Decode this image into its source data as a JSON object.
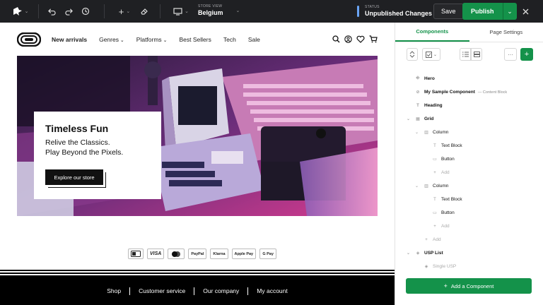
{
  "toolbar": {
    "store_view_caption": "STORE VIEW",
    "store_view_value": "Belgium",
    "status_caption": "STATUS",
    "status_value": "Unpublished Changes",
    "save_label": "Save",
    "publish_label": "Publish",
    "status_color": "#6aa5f5",
    "publish_color": "#14924a"
  },
  "store": {
    "nav": [
      {
        "label": "New arrivals",
        "active": true
      },
      {
        "label": "Genres",
        "dropdown": true
      },
      {
        "label": "Platforms",
        "dropdown": true
      },
      {
        "label": "Best Sellers"
      },
      {
        "label": "Tech"
      },
      {
        "label": "Sale",
        "color": "#e0262b"
      }
    ],
    "hero": {
      "title": "Timeless Fun",
      "subtitle_line1": "Relive the Classics.",
      "subtitle_line2": "Play Beyond the Pixels.",
      "button_label": "Explore our store"
    },
    "payments": [
      "VISA",
      "PayPal",
      "Klarna",
      "Apple Pay",
      "G Pay"
    ],
    "footer_links": [
      "Shop",
      "Customer service",
      "Our company",
      "My account"
    ]
  },
  "panel": {
    "tabs": [
      "Components",
      "Page Settings"
    ],
    "active_tab": "Components",
    "tree": [
      {
        "label": "Hero",
        "depth": 0,
        "bold": true,
        "icon": "hero-icon"
      },
      {
        "label": "My Sample Component",
        "meta": "— Content Block",
        "depth": 0,
        "bold": true,
        "icon": "link-icon"
      },
      {
        "label": "Heading",
        "depth": 0,
        "bold": true,
        "icon": "text-icon"
      },
      {
        "label": "Grid",
        "depth": 0,
        "bold": true,
        "icon": "grid-icon",
        "expanded": true
      },
      {
        "label": "Column",
        "depth": 1,
        "icon": "column-icon",
        "expanded": true
      },
      {
        "label": "Text Block",
        "depth": 2,
        "icon": "text-icon"
      },
      {
        "label": "Button",
        "depth": 2,
        "icon": "button-icon"
      },
      {
        "label": "Add",
        "depth": 2,
        "muted": true,
        "icon": "plus-icon"
      },
      {
        "label": "Column",
        "depth": 1,
        "icon": "column-icon",
        "expanded": true
      },
      {
        "label": "Text Block",
        "depth": 2,
        "icon": "text-icon"
      },
      {
        "label": "Button",
        "depth": 2,
        "icon": "button-icon"
      },
      {
        "label": "Add",
        "depth": 2,
        "muted": true,
        "icon": "plus-icon"
      },
      {
        "label": "Add",
        "depth": 1,
        "muted": true,
        "icon": "plus-icon"
      },
      {
        "label": "USP List",
        "depth": 0,
        "bold": true,
        "icon": "usp-icon",
        "expanded": true
      },
      {
        "label": "Single USP",
        "depth": 1,
        "muted": true,
        "icon": "usp-icon"
      }
    ],
    "add_component_label": "Add a Component"
  }
}
